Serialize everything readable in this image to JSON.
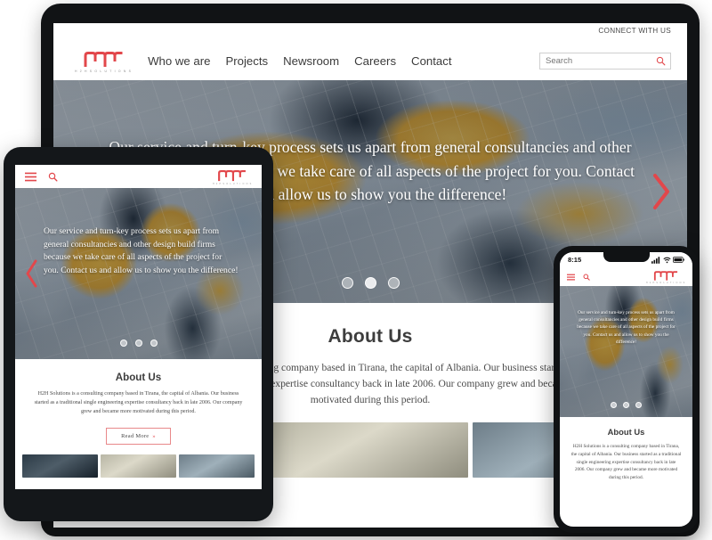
{
  "brand": {
    "name": "H2H SOLUTIONS",
    "logo_sub": "H 2 H   S O L U T I O N S",
    "accent_color": "#e2474b",
    "logo_icon": "h2h-zigzag-logo-icon"
  },
  "desktop": {
    "topbar": {
      "connect_label": "CONNECT WITH US"
    },
    "nav": [
      {
        "label": "Who we are"
      },
      {
        "label": "Projects"
      },
      {
        "label": "Newsroom"
      },
      {
        "label": "Careers"
      },
      {
        "label": "Contact"
      }
    ],
    "search": {
      "value": "",
      "placeholder": "Search",
      "icon": "search-icon"
    },
    "hero": {
      "text": "Our service and turn-key process sets us apart from general consultancies and other design build firms because we take care of all aspects of the project for you. Contact us and allow us to show you the difference!",
      "next_arrow_icon": "chevron-right-icon",
      "dots": 3,
      "active_dot": 2
    },
    "about": {
      "title": "About Us",
      "body": "H2H Solutions is a consulting company based in Tirana, the capital of Albania. Our business started as a traditional single engineering expertise consultancy back in late 2006. Our company grew and became more motivated during this period."
    }
  },
  "tablet": {
    "header": {
      "menu_icon": "hamburger-menu-icon",
      "search_icon": "search-icon"
    },
    "hero": {
      "text": "Our service and turn-key process sets us apart from general consultancies and other design build firms because we take care of all aspects of the project for you. Contact us and allow us to show you the difference!",
      "prev_arrow_icon": "chevron-left-icon",
      "dots": 3,
      "active_dot": 1
    },
    "about": {
      "title": "About Us",
      "body": "H2H Solutions is a consulting company based in Tirana, the capital of Albania. Our business started as a traditional single engineering expertise consultancy back in late 2006. Our company grew and became more motivated during this period.",
      "read_more_label": "Read More",
      "read_more_chevron": "»"
    }
  },
  "phone": {
    "status": {
      "time": "8:15",
      "signal_icon": "cellular-signal-icon",
      "wifi_icon": "wifi-icon",
      "battery_icon": "battery-icon"
    },
    "header": {
      "menu_icon": "hamburger-menu-icon",
      "search_icon": "search-icon"
    },
    "hero": {
      "text": "Our service and turn-key process sets us apart from general consultancies and other design build firms because we take care of all aspects of the project for you. Contact us and allow us to show you the difference!",
      "dots": 3,
      "active_dot": 1
    },
    "about": {
      "title": "About Us",
      "body": "H2H Solutions is a consulting company based in Tirana, the capital of Albania. Our business started as a traditional single engineering expertise consultancy back in late 2006. Our company grew and became more motivated during this period."
    }
  }
}
